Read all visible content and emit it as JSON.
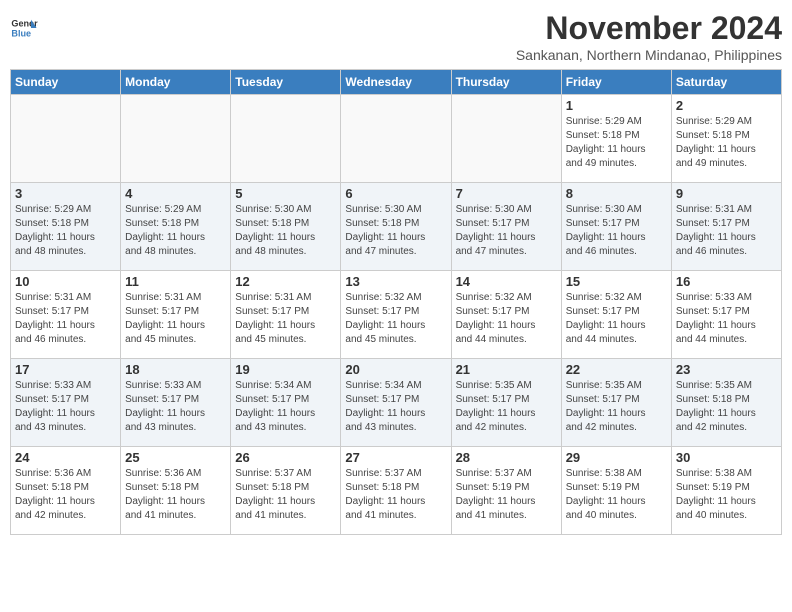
{
  "header": {
    "logo_line1": "General",
    "logo_line2": "Blue",
    "month": "November 2024",
    "location": "Sankanan, Northern Mindanao, Philippines"
  },
  "weekdays": [
    "Sunday",
    "Monday",
    "Tuesday",
    "Wednesday",
    "Thursday",
    "Friday",
    "Saturday"
  ],
  "weeks": [
    [
      {
        "day": "",
        "info": ""
      },
      {
        "day": "",
        "info": ""
      },
      {
        "day": "",
        "info": ""
      },
      {
        "day": "",
        "info": ""
      },
      {
        "day": "",
        "info": ""
      },
      {
        "day": "1",
        "info": "Sunrise: 5:29 AM\nSunset: 5:18 PM\nDaylight: 11 hours\nand 49 minutes."
      },
      {
        "day": "2",
        "info": "Sunrise: 5:29 AM\nSunset: 5:18 PM\nDaylight: 11 hours\nand 49 minutes."
      }
    ],
    [
      {
        "day": "3",
        "info": "Sunrise: 5:29 AM\nSunset: 5:18 PM\nDaylight: 11 hours\nand 48 minutes."
      },
      {
        "day": "4",
        "info": "Sunrise: 5:29 AM\nSunset: 5:18 PM\nDaylight: 11 hours\nand 48 minutes."
      },
      {
        "day": "5",
        "info": "Sunrise: 5:30 AM\nSunset: 5:18 PM\nDaylight: 11 hours\nand 48 minutes."
      },
      {
        "day": "6",
        "info": "Sunrise: 5:30 AM\nSunset: 5:18 PM\nDaylight: 11 hours\nand 47 minutes."
      },
      {
        "day": "7",
        "info": "Sunrise: 5:30 AM\nSunset: 5:17 PM\nDaylight: 11 hours\nand 47 minutes."
      },
      {
        "day": "8",
        "info": "Sunrise: 5:30 AM\nSunset: 5:17 PM\nDaylight: 11 hours\nand 46 minutes."
      },
      {
        "day": "9",
        "info": "Sunrise: 5:31 AM\nSunset: 5:17 PM\nDaylight: 11 hours\nand 46 minutes."
      }
    ],
    [
      {
        "day": "10",
        "info": "Sunrise: 5:31 AM\nSunset: 5:17 PM\nDaylight: 11 hours\nand 46 minutes."
      },
      {
        "day": "11",
        "info": "Sunrise: 5:31 AM\nSunset: 5:17 PM\nDaylight: 11 hours\nand 45 minutes."
      },
      {
        "day": "12",
        "info": "Sunrise: 5:31 AM\nSunset: 5:17 PM\nDaylight: 11 hours\nand 45 minutes."
      },
      {
        "day": "13",
        "info": "Sunrise: 5:32 AM\nSunset: 5:17 PM\nDaylight: 11 hours\nand 45 minutes."
      },
      {
        "day": "14",
        "info": "Sunrise: 5:32 AM\nSunset: 5:17 PM\nDaylight: 11 hours\nand 44 minutes."
      },
      {
        "day": "15",
        "info": "Sunrise: 5:32 AM\nSunset: 5:17 PM\nDaylight: 11 hours\nand 44 minutes."
      },
      {
        "day": "16",
        "info": "Sunrise: 5:33 AM\nSunset: 5:17 PM\nDaylight: 11 hours\nand 44 minutes."
      }
    ],
    [
      {
        "day": "17",
        "info": "Sunrise: 5:33 AM\nSunset: 5:17 PM\nDaylight: 11 hours\nand 43 minutes."
      },
      {
        "day": "18",
        "info": "Sunrise: 5:33 AM\nSunset: 5:17 PM\nDaylight: 11 hours\nand 43 minutes."
      },
      {
        "day": "19",
        "info": "Sunrise: 5:34 AM\nSunset: 5:17 PM\nDaylight: 11 hours\nand 43 minutes."
      },
      {
        "day": "20",
        "info": "Sunrise: 5:34 AM\nSunset: 5:17 PM\nDaylight: 11 hours\nand 43 minutes."
      },
      {
        "day": "21",
        "info": "Sunrise: 5:35 AM\nSunset: 5:17 PM\nDaylight: 11 hours\nand 42 minutes."
      },
      {
        "day": "22",
        "info": "Sunrise: 5:35 AM\nSunset: 5:17 PM\nDaylight: 11 hours\nand 42 minutes."
      },
      {
        "day": "23",
        "info": "Sunrise: 5:35 AM\nSunset: 5:18 PM\nDaylight: 11 hours\nand 42 minutes."
      }
    ],
    [
      {
        "day": "24",
        "info": "Sunrise: 5:36 AM\nSunset: 5:18 PM\nDaylight: 11 hours\nand 42 minutes."
      },
      {
        "day": "25",
        "info": "Sunrise: 5:36 AM\nSunset: 5:18 PM\nDaylight: 11 hours\nand 41 minutes."
      },
      {
        "day": "26",
        "info": "Sunrise: 5:37 AM\nSunset: 5:18 PM\nDaylight: 11 hours\nand 41 minutes."
      },
      {
        "day": "27",
        "info": "Sunrise: 5:37 AM\nSunset: 5:18 PM\nDaylight: 11 hours\nand 41 minutes."
      },
      {
        "day": "28",
        "info": "Sunrise: 5:37 AM\nSunset: 5:19 PM\nDaylight: 11 hours\nand 41 minutes."
      },
      {
        "day": "29",
        "info": "Sunrise: 5:38 AM\nSunset: 5:19 PM\nDaylight: 11 hours\nand 40 minutes."
      },
      {
        "day": "30",
        "info": "Sunrise: 5:38 AM\nSunset: 5:19 PM\nDaylight: 11 hours\nand 40 minutes."
      }
    ]
  ]
}
